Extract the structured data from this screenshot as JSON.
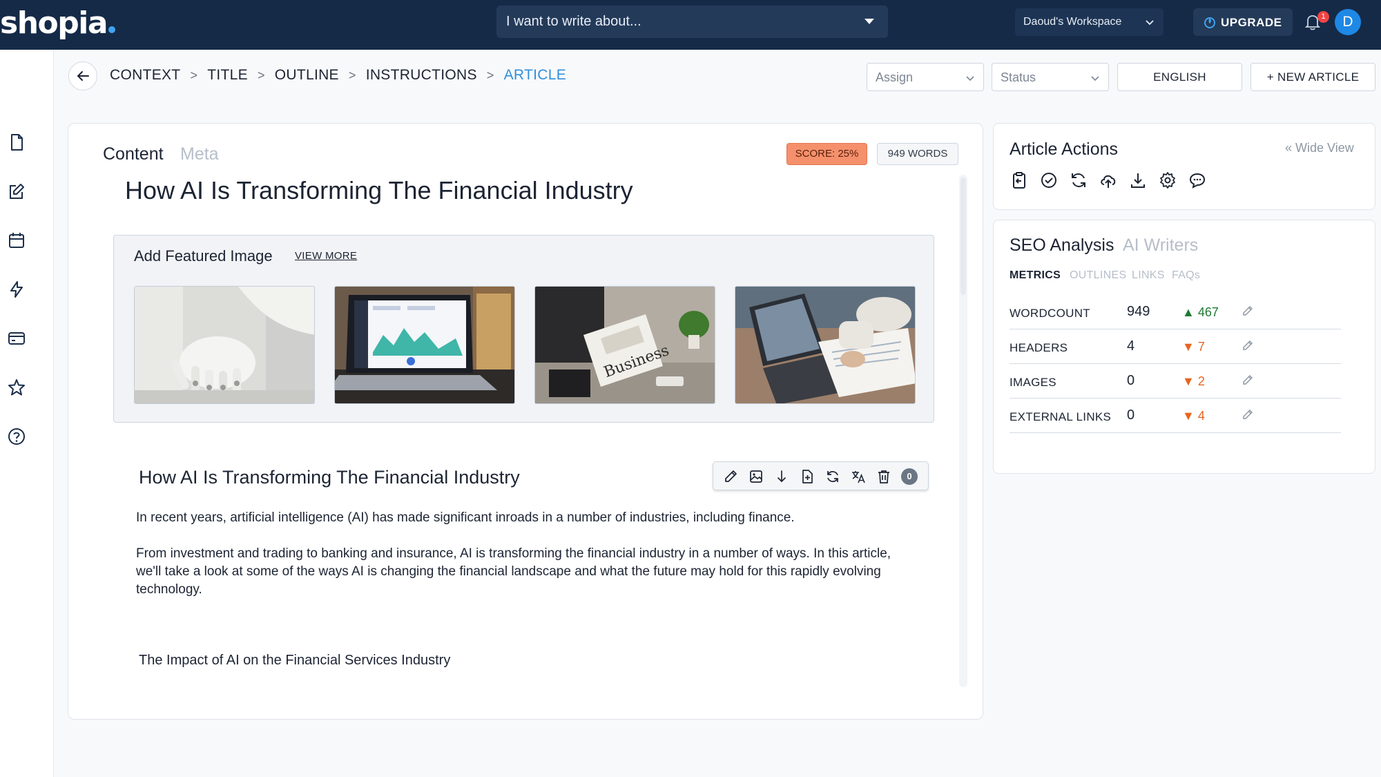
{
  "topbar": {
    "logo": "shopia",
    "topic_placeholder": "I want to write about...",
    "workspace": "Daoud's Workspace",
    "upgrade_label": "UPGRADE",
    "notification_count": "1",
    "avatar_initial": "D"
  },
  "sidebar": {
    "items": [
      {
        "icon": "document-icon"
      },
      {
        "icon": "edit-icon"
      },
      {
        "icon": "calendar-icon"
      },
      {
        "icon": "lightning-icon"
      },
      {
        "icon": "credit-card-icon"
      },
      {
        "icon": "star-icon"
      },
      {
        "icon": "help-icon"
      }
    ]
  },
  "breadcrumb": {
    "steps": [
      "CONTEXT",
      "TITLE",
      "OUTLINE",
      "INSTRUCTIONS",
      "ARTICLE"
    ],
    "active": "ARTICLE"
  },
  "header_controls": {
    "assign_placeholder": "Assign",
    "status_placeholder": "Status",
    "language_label": "ENGLISH",
    "new_article_label": "+ NEW ARTICLE"
  },
  "editor": {
    "tab_content": "Content",
    "tab_meta": "Meta",
    "score_label": "SCORE: 25%",
    "words_label": "949 WORDS",
    "title": "How AI Is Transforming The Financial Industry",
    "featured_image": {
      "title": "Add Featured Image",
      "view_more": "VIEW MORE",
      "images": [
        "robot-hand-photo",
        "laptop-dashboard-photo",
        "business-newspaper-photo",
        "laptop-paperwork-photo"
      ]
    },
    "section_title": "How AI Is Transforming The Financial Industry",
    "toolbar_count": "0",
    "paragraphs": [
      "In recent years, artificial intelligence (AI) has made significant inroads in a number of industries, including finance.",
      "From investment and trading to banking and insurance, AI is transforming the financial industry in a number of ways. In this article, we'll take a look at some of the ways AI is changing the financial landscape and what the future may hold for this rapidly evolving technology."
    ],
    "subheading": "The Impact of AI on the Financial Services Industry"
  },
  "article_actions": {
    "title": "Article Actions",
    "wide_view": "Wide View",
    "icons": [
      "clipboard-icon",
      "check-circle-icon",
      "refresh-icon",
      "cloud-upload-icon",
      "download-icon",
      "settings-icon",
      "comment-icon"
    ]
  },
  "seo": {
    "title": "SEO Analysis",
    "ai_writers": "AI Writers",
    "tabs": [
      "METRICS",
      "OUTLINES",
      "LINKS",
      "FAQs"
    ],
    "metrics": [
      {
        "label": "WORDCOUNT",
        "value": "949",
        "delta": "467",
        "direction": "up"
      },
      {
        "label": "HEADERS",
        "value": "4",
        "delta": "7",
        "direction": "down"
      },
      {
        "label": "IMAGES",
        "value": "0",
        "delta": "2",
        "direction": "down"
      },
      {
        "label": "EXTERNAL LINKS",
        "value": "0",
        "delta": "4",
        "direction": "down"
      }
    ]
  },
  "colors": {
    "topbar": "#152a47",
    "accent": "#2f8fdc",
    "score_bg": "#f5906c",
    "up": "#1f7a35",
    "down": "#e8641e"
  }
}
